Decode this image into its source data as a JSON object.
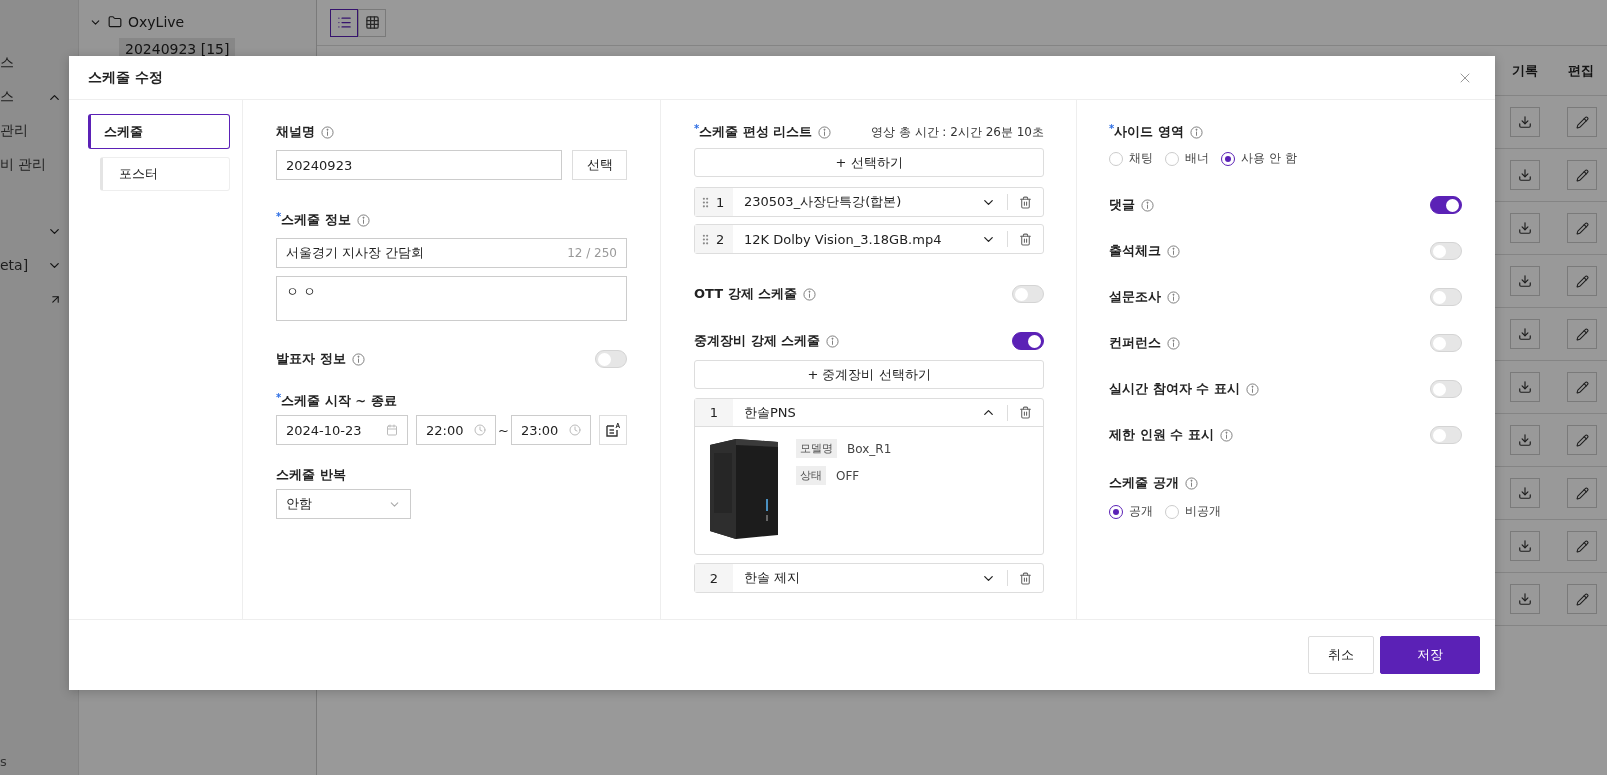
{
  "sidebar": {
    "items": [
      {
        "kind": "text",
        "label": "스"
      },
      {
        "kind": "group",
        "label": "스",
        "expanded": true
      },
      {
        "kind": "text",
        "label": "관리"
      },
      {
        "kind": "text",
        "label": "비 관리"
      },
      {
        "kind": "chevron",
        "expanded": false
      },
      {
        "kind": "group",
        "label": "eta]",
        "expanded": false
      },
      {
        "kind": "link"
      }
    ],
    "footer": "s"
  },
  "tree": {
    "label": "OxyLive",
    "expanded": true,
    "children": [
      {
        "label": "20240923 [15]",
        "selected": true
      }
    ]
  },
  "view_modes": [
    {
      "kind": "list",
      "selected": true
    },
    {
      "kind": "grid",
      "selected": false
    }
  ],
  "table": {
    "columns": [
      "기록",
      "편집"
    ],
    "rows": [
      {
        "kind": "actions"
      },
      {
        "kind": "actions"
      },
      {
        "kind": "actions"
      },
      {
        "kind": "actions"
      },
      {
        "kind": "actions"
      },
      {
        "kind": "actions"
      },
      {
        "kind": "actions"
      },
      {
        "kind": "actions"
      },
      {
        "kind": "actions"
      },
      {
        "kind": "actions"
      }
    ]
  },
  "dialog": {
    "title": "스케줄 수정",
    "nav": [
      {
        "label": "스케줄",
        "kind": "main",
        "selected": true
      },
      {
        "label": "포스터",
        "kind": "sub",
        "selected": false
      }
    ],
    "channel": {
      "label": "채널명",
      "value": "20240923",
      "button": "선택"
    },
    "info": {
      "label": "스케줄 정보",
      "required_mark": "*",
      "title_value": "서울경기 지사장 간담회",
      "counter": "12 / 250",
      "description": "ㅇ ㅇ"
    },
    "presenter": {
      "label": "발표자 정보",
      "on": false
    },
    "period": {
      "label": "스케줄 시작 ~ 종료",
      "required_mark": "*",
      "date": "2024-10-23",
      "start": "22:00",
      "separator": "~",
      "end": "23:00"
    },
    "repeat": {
      "label": "스케줄 반복",
      "value": "안함"
    },
    "playlist": {
      "label": "스케줄 편성 리스트",
      "required_mark": "*",
      "total": "영상 총 시간 : 2시간 26분 10초",
      "add_button": "+ 선택하기",
      "items": [
        {
          "index": "1",
          "title": "230503_사장단특강(합본)",
          "expanded": false
        },
        {
          "index": "2",
          "title": "12K Dolby Vision_3.18GB.mp4",
          "expanded": false
        }
      ]
    },
    "ott": {
      "label": "OTT 강제 스케줄",
      "on": false
    },
    "relay": {
      "label": "중계장비 강제 스케줄",
      "on": true,
      "add_button": "+ 중계장비 선택하기",
      "devices": [
        {
          "index": "1",
          "name": "한솔PNS",
          "expanded": true,
          "details": [
            {
              "key": "모델명",
              "value": "Box_R1"
            },
            {
              "key": "상태",
              "value": "OFF"
            }
          ]
        },
        {
          "index": "2",
          "name": "한솔 제지",
          "expanded": false
        }
      ]
    },
    "side_area": {
      "label": "사이드 영역",
      "required_mark": "*",
      "options": [
        {
          "label": "채팅",
          "selected": false
        },
        {
          "label": "배너",
          "selected": false
        },
        {
          "label": "사용 안 함",
          "selected": true
        }
      ]
    },
    "toggles": [
      {
        "label": "댓글",
        "on": true
      },
      {
        "label": "출석체크",
        "on": false
      },
      {
        "label": "설문조사",
        "on": false
      },
      {
        "label": "컨퍼런스",
        "on": false
      },
      {
        "label": "실시간 참여자 수 표시",
        "on": false
      },
      {
        "label": "제한 인원 수 표시",
        "on": false
      }
    ],
    "visibility": {
      "label": "스케줄 공개",
      "options": [
        {
          "label": "공개",
          "selected": true
        },
        {
          "label": "비공개",
          "selected": false
        }
      ]
    },
    "cancel_button": "취소",
    "save_button": "저장"
  }
}
